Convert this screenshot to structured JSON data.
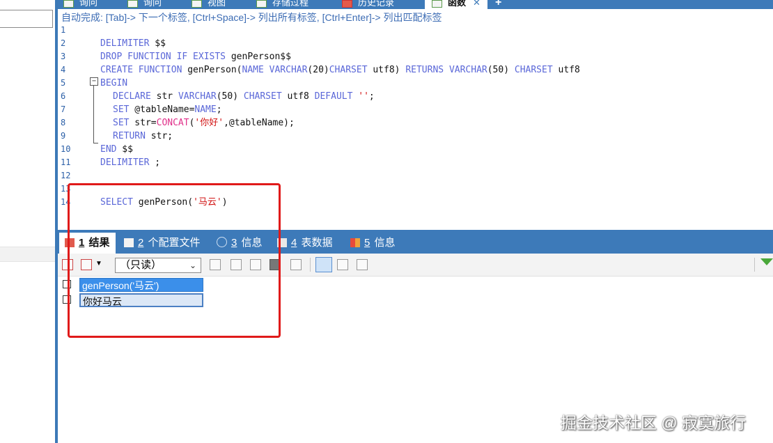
{
  "top_tabs": [
    {
      "label": "询问",
      "icon": "query-icon"
    },
    {
      "label": "询问",
      "icon": "query-icon"
    },
    {
      "label": "视图",
      "icon": "view-icon"
    },
    {
      "label": "存储过程",
      "icon": "procedure-icon"
    },
    {
      "label": "历史记录",
      "icon": "history-icon"
    },
    {
      "label": "函数",
      "icon": "function-icon",
      "active": true
    }
  ],
  "tab_close": "✕",
  "tab_add": "+",
  "hint": "自动完成: [Tab]-> 下一个标签, [Ctrl+Space]-> 列出所有标签, [Ctrl+Enter]-> 列出匹配标签",
  "editor": {
    "line_numbers": [
      "1",
      "2",
      "3",
      "4",
      "5",
      "6",
      "7",
      "8",
      "9",
      "10",
      "11",
      "12",
      "13",
      "14"
    ],
    "lines": {
      "l2": {
        "a": "DELIMITER",
        "b": " $$"
      },
      "l3": {
        "a": "DROP FUNCTION IF EXISTS",
        "b": " genPerson$$"
      },
      "l4": {
        "a": "CREATE FUNCTION",
        "b": " genPerson(",
        "c": "NAME VARCHAR",
        "d": "(20)",
        "e": "CHARSET",
        "f": " utf8) ",
        "g": "RETURNS VARCHAR",
        "h": "(50) ",
        "i": "CHARSET",
        "j": " utf8"
      },
      "l5": {
        "a": "BEGIN"
      },
      "l6": {
        "a": "DECLARE",
        "b": " str ",
        "c": "VARCHAR",
        "d": "(50) ",
        "e": "CHARSET",
        "f": " utf8 ",
        "g": "DEFAULT",
        "h": " ''",
        "i": ";"
      },
      "l7": {
        "a": "SET",
        "b": " @tableName=",
        "c": "NAME",
        "d": ";"
      },
      "l8": {
        "a": "SET",
        "b": " str=",
        "c": "CONCAT",
        "d": "(",
        "e": "'你好'",
        "f": ",@tableName);"
      },
      "l9": {
        "a": "RETURN",
        "b": " str;"
      },
      "l10": {
        "a": "END",
        "b": " $$"
      },
      "l11": {
        "a": "DELIMITER",
        "b": " ;"
      },
      "l14": {
        "a": "SELECT",
        "b": " genPerson(",
        "c": "'马云'",
        "d": ")"
      }
    }
  },
  "result_tabs": [
    {
      "num": "1",
      "label": " 结果",
      "active": true
    },
    {
      "num": "2",
      "label": " 个配置文件"
    },
    {
      "num": "3",
      "label": " 信息"
    },
    {
      "num": "4",
      "label": " 表数据"
    },
    {
      "num": "5",
      "label": " 信息"
    }
  ],
  "toolbar": {
    "readonly": "（只读）"
  },
  "grid": {
    "header": "genPerson('马云')",
    "value": "你好马云"
  },
  "watermark": "掘金技术社区 @ 寂寞旅行",
  "colors": {
    "accent": "#3d7ab9",
    "keyword": "#5a67d8",
    "string": "#d11111",
    "highlight": "#e01a1a"
  }
}
